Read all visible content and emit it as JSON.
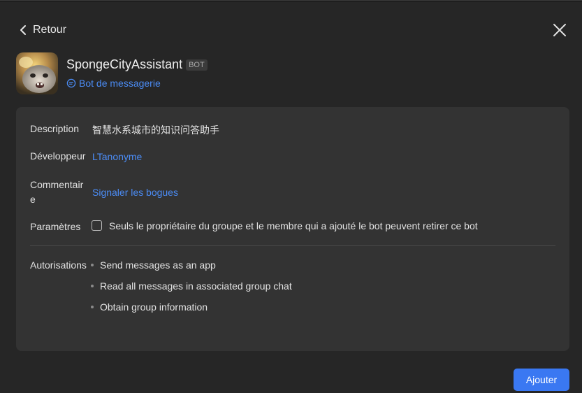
{
  "nav": {
    "back_label": "Retour"
  },
  "bot": {
    "name": "SpongeCityAssistant",
    "badge": "BOT",
    "type_label": "Bot de messagerie"
  },
  "details": {
    "description_label": "Description",
    "description_value": "智慧水系城市的知识问答助手",
    "developer_label": "Développeur",
    "developer_value": "LTanonyme",
    "comment_label_line1": "Commentair",
    "comment_label_line2": "e",
    "comment_value": "Signaler les bogues",
    "settings_label": "Paramètres",
    "settings_option": "Seuls le propriétaire du groupe et le membre qui a ajouté le bot peuvent retirer ce bot",
    "settings_checked": false,
    "permissions_label": "Autorisations",
    "permissions": [
      "Send messages as an app",
      "Read all messages in associated group chat",
      "Obtain group information"
    ]
  },
  "actions": {
    "add_label": "Ajouter"
  },
  "colors": {
    "accent": "#3a78f2",
    "link": "#4b8cf5",
    "card": "#333333",
    "panel": "#262626"
  }
}
